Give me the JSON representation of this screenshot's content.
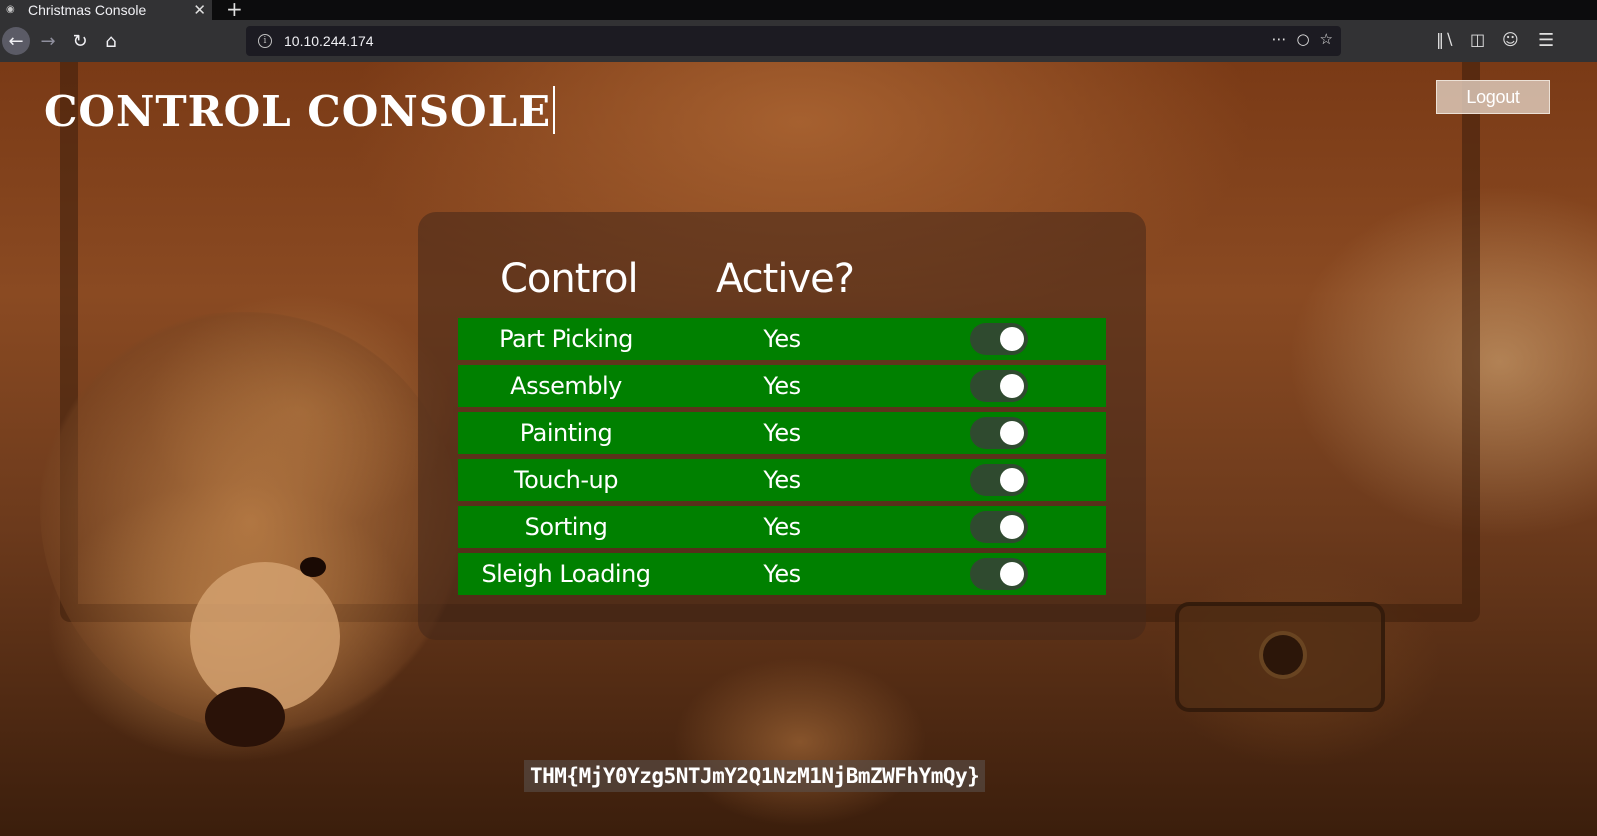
{
  "browser": {
    "tab_title": "Christmas Console",
    "url": "10.10.244.174"
  },
  "page": {
    "title": "CONTROL CONSOLE",
    "logout_label": "Logout",
    "flag": "THM{MjY0Yzg5NTJmY2Q1NzM1NjBmZWFhYmQy}"
  },
  "table": {
    "headers": [
      "Control",
      "Active?"
    ],
    "rows": [
      {
        "name": "Part Picking",
        "active": "Yes",
        "on": true
      },
      {
        "name": "Assembly",
        "active": "Yes",
        "on": true
      },
      {
        "name": "Painting",
        "active": "Yes",
        "on": true
      },
      {
        "name": "Touch-up",
        "active": "Yes",
        "on": true
      },
      {
        "name": "Sorting",
        "active": "Yes",
        "on": true
      },
      {
        "name": "Sleigh Loading",
        "active": "Yes",
        "on": true
      }
    ]
  },
  "colors": {
    "row_bg": "#008000",
    "toggle_track": "#2f4a2f",
    "toggle_knob": "#ffffff"
  }
}
